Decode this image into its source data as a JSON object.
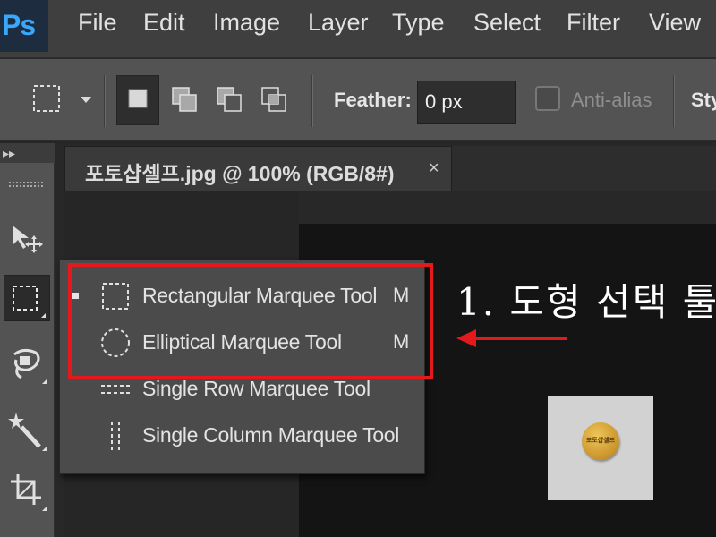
{
  "app": {
    "logo": "Ps",
    "menu": [
      "File",
      "Edit",
      "Image",
      "Layer",
      "Type",
      "Select",
      "Filter",
      "View"
    ]
  },
  "options_bar": {
    "feather_label": "Feather:",
    "feather_value": "0 px",
    "antialias_label": "Anti-alias",
    "antialias_checked": false,
    "style_label": "Sty"
  },
  "document": {
    "tab_title": "포토샵셀프.jpg @ 100% (RGB/8#)",
    "close_glyph": "×"
  },
  "flyout": {
    "items": [
      {
        "label": "Rectangular Marquee Tool",
        "shortcut": "M",
        "selected": true,
        "icon": "rectangular-marquee-icon"
      },
      {
        "label": "Elliptical Marquee Tool",
        "shortcut": "M",
        "selected": false,
        "icon": "elliptical-marquee-icon"
      },
      {
        "label": "Single Row Marquee Tool",
        "shortcut": "",
        "selected": false,
        "icon": "single-row-marquee-icon"
      },
      {
        "label": "Single Column Marquee Tool",
        "shortcut": "",
        "selected": false,
        "icon": "single-column-marquee-icon"
      }
    ]
  },
  "annotation": {
    "text": "1. 도형 선택 툴",
    "color": "#e3191c"
  },
  "thumbnail": {
    "coin_text": "포토샵셀프"
  },
  "toolbar": {
    "tools": [
      "move-tool-icon",
      "marquee-tool-icon",
      "lasso-tool-icon",
      "magic-wand-icon",
      "crop-tool-icon"
    ]
  }
}
